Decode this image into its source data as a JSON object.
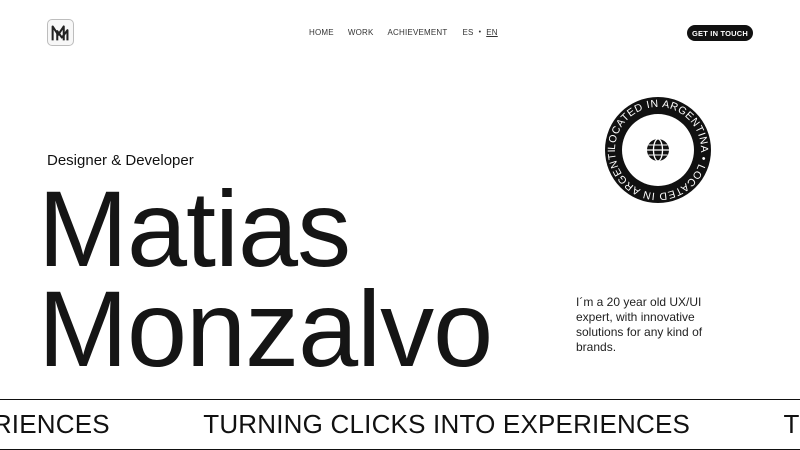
{
  "header": {
    "logo_icon": "mm-monogram-logo",
    "nav": {
      "home": "HOME",
      "work": "WORK",
      "achievement": "ACHIEVEMENT",
      "lang_es": "ES",
      "lang_sep": "•",
      "lang_en": "EN"
    },
    "cta_label": "GET IN TOUCH"
  },
  "hero": {
    "subtitle": "Designer & Developer",
    "first_name": "Matias",
    "last_name": "Monzalvo",
    "bio": "I´m a 20 year old UX/UI expert, with innovative solutions for any kind of brands."
  },
  "badge": {
    "text": "LOCATED IN ARGENTINA • LOCATED IN ARGENTINA •",
    "icon": "globe-icon"
  },
  "marquee": {
    "items": [
      "TURNING CLICKS INTO EXPERIENCES",
      "TURNING CLICKS INTO EXPERIENCES",
      "TURNING CLICKS INTO EXPERIENCES"
    ]
  },
  "colors": {
    "text": "#1a1a1a",
    "button_bg": "#111111",
    "background": "#ffffff"
  }
}
